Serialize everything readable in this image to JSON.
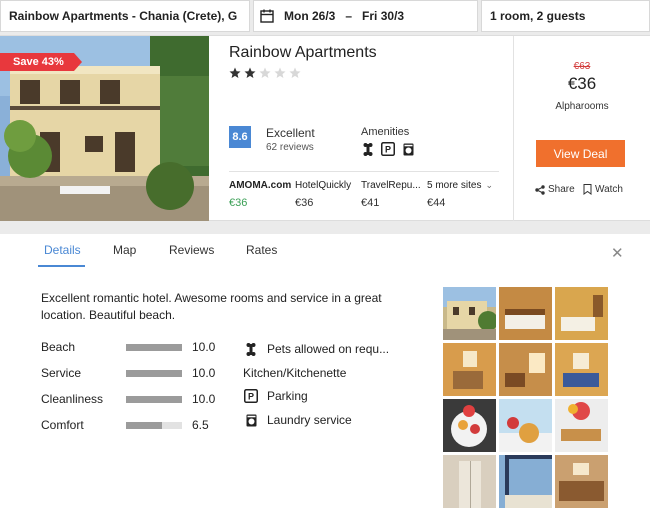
{
  "search": {
    "destination": "Rainbow Apartments - Chania (Crete), G",
    "check_in": "Mon 26/3",
    "date_separator": "–",
    "check_out": "Fri 30/3",
    "guests": "1 room, 2 guests"
  },
  "hotel": {
    "badge": "Save 43%",
    "name": "Rainbow Apartments",
    "stars": 2,
    "max_stars": 5,
    "score": "8.6",
    "rating_label": "Excellent",
    "review_count": "62 reviews",
    "amenities_label": "Amenities",
    "amenity_icons": [
      "pet-icon",
      "parking-icon",
      "laundry-icon"
    ],
    "prices": [
      {
        "site": "AMOMA.com",
        "amount": "€36"
      },
      {
        "site": "HotelQuickly",
        "amount": "€36"
      },
      {
        "site": "TravelRepu...",
        "amount": "€41"
      }
    ],
    "more_sites": {
      "label": "5 more sites",
      "amount": "€44"
    },
    "old_price": "€63",
    "best_price": "€36",
    "provider": "Alpharooms",
    "deal_button": "View Deal",
    "share_label": "Share",
    "watch_label": "Watch",
    "colors": {
      "accent": "#4a88d4",
      "deal": "#f0702d",
      "badge": "#e8383d",
      "best_price": "#3a9f55"
    }
  },
  "details": {
    "tabs": [
      "Details",
      "Map",
      "Reviews",
      "Rates"
    ],
    "active_tab": "Details",
    "description": "Excellent romantic hotel. Awesome rooms and service in a great location. Beautiful beach.",
    "ratings": [
      {
        "label": "Beach",
        "value": "10.0",
        "fraction": 1.0
      },
      {
        "label": "Service",
        "value": "10.0",
        "fraction": 1.0
      },
      {
        "label": "Cleanliness",
        "value": "10.0",
        "fraction": 1.0
      },
      {
        "label": "Comfort",
        "value": "6.5",
        "fraction": 0.65
      }
    ],
    "facilities": [
      {
        "icon": "pet-icon",
        "label": "Pets allowed on requ..."
      },
      {
        "icon": "",
        "label": "Kitchen/Kitchenette"
      },
      {
        "icon": "parking-icon",
        "label": "Parking"
      },
      {
        "icon": "laundry-icon",
        "label": "Laundry service"
      }
    ],
    "gallery_count": 12
  }
}
